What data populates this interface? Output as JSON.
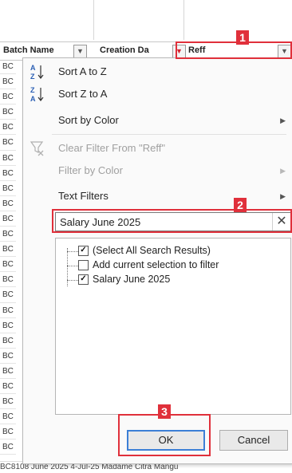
{
  "header": {
    "col_a": "Batch Name",
    "col_b": "Creation Da",
    "col_c": "Reff"
  },
  "rows_prefix": "BC",
  "bottom_row_text": "BC8108 June 2025        4-Jul-25  Madame Citra Mangu",
  "menu": {
    "items": [
      {
        "label": "Sort A to Z",
        "icon": "sort-az-icon"
      },
      {
        "label": "Sort Z to A",
        "icon": "sort-za-icon"
      },
      {
        "label": "Sort by Color",
        "icon": "",
        "submenu": true
      },
      {
        "label": "Clear Filter From \"Reff\"",
        "icon": "clear-filter-icon",
        "disabled": true
      },
      {
        "label": "Filter by Color",
        "icon": "",
        "submenu": true,
        "disabled": true
      },
      {
        "label": "Text Filters",
        "icon": "",
        "submenu": true
      }
    ],
    "search": {
      "value": "Salary June 2025"
    },
    "list": [
      {
        "label": "(Select All Search Results)",
        "checked": true
      },
      {
        "label": "Add current selection to filter",
        "checked": false
      },
      {
        "label": "Salary June 2025",
        "checked": true
      }
    ],
    "ok_label": "OK",
    "cancel_label": "Cancel"
  },
  "annotations": [
    "1",
    "2",
    "3"
  ],
  "colors": {
    "annotation": "#e0303b",
    "ok_border": "#3c7fd6"
  }
}
